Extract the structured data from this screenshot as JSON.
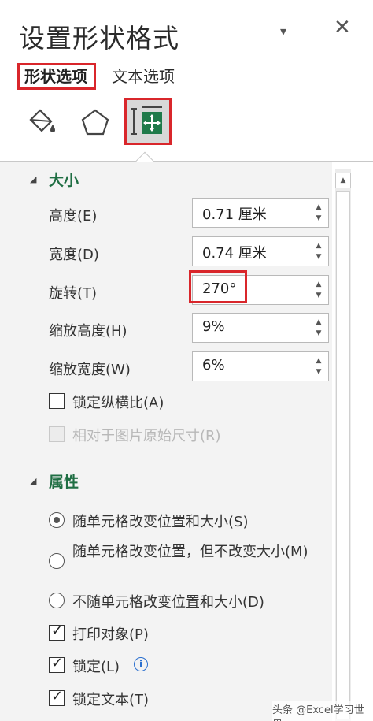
{
  "panel": {
    "title": "设置形状格式",
    "dropdown_icon": "▾",
    "close_icon": "✕"
  },
  "tabs": [
    {
      "label": "形状选项",
      "selected": true
    },
    {
      "label": "文本选项",
      "selected": false
    }
  ],
  "icons": [
    "fill-line-icon",
    "effects-pentagon-icon",
    "size-properties-icon"
  ],
  "size_section": {
    "header": "大小",
    "height": {
      "label": "高度(E)",
      "value": "0.71 厘米"
    },
    "width": {
      "label": "宽度(D)",
      "value": "0.74 厘米"
    },
    "rotation": {
      "label": "旋转(T)",
      "value": "270°"
    },
    "scale_height": {
      "label": "缩放高度(H)",
      "value": "9%"
    },
    "scale_width": {
      "label": "缩放宽度(W)",
      "value": "6%"
    },
    "lock_aspect": {
      "label": "锁定纵横比(A)",
      "checked": false
    },
    "relative_to_original": {
      "label": "相对于图片原始尺寸(R)",
      "checked": false,
      "disabled": true
    }
  },
  "properties_section": {
    "header": "属性",
    "radio_move_size": {
      "label": "随单元格改变位置和大小(S)",
      "selected": true
    },
    "radio_move_only": {
      "label": "随单元格改变位置，但不改变大小(M)",
      "selected": false
    },
    "radio_none": {
      "label": "不随单元格改变位置和大小(D)",
      "selected": false
    },
    "print_object": {
      "label": "打印对象(P)",
      "checked": true
    },
    "locked": {
      "label": "锁定(L)",
      "checked": true
    },
    "lock_text": {
      "label": "锁定文本(T)",
      "checked": true
    }
  },
  "watermark": "头条 @Excel学习世界",
  "colors": {
    "accent_green": "#1f6e43",
    "highlight_red": "#d9262b"
  }
}
